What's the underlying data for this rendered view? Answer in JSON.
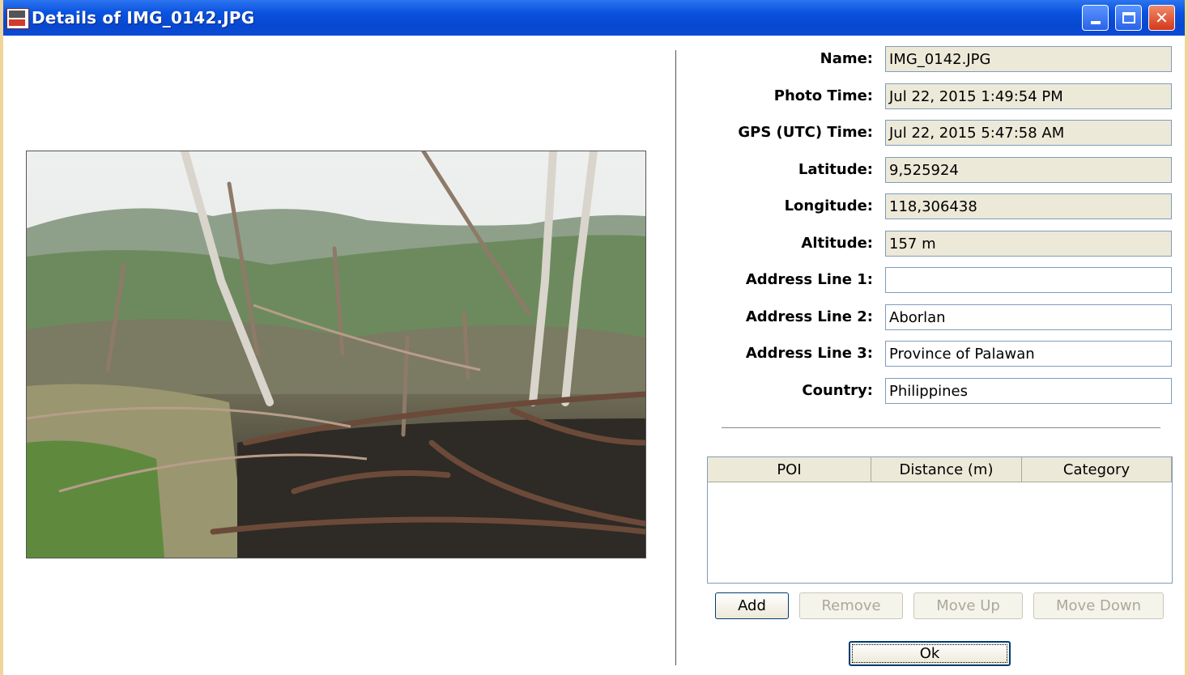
{
  "window": {
    "title": "Details of IMG_0142.JPG",
    "icon": "gps-photo-app-icon"
  },
  "photo": {
    "description_icon": "photo-preview"
  },
  "fields": [
    {
      "label": "Name:",
      "value": "IMG_0142.JPG",
      "editable": false
    },
    {
      "label": "Photo Time:",
      "value": "Jul 22, 2015 1:49:54 PM",
      "editable": false
    },
    {
      "label": "GPS (UTC) Time:",
      "value": "Jul 22, 2015 5:47:58 AM",
      "editable": false
    },
    {
      "label": "Latitude:",
      "value": "9,525924",
      "editable": false
    },
    {
      "label": "Longitude:",
      "value": "118,306438",
      "editable": false
    },
    {
      "label": "Altitude:",
      "value": "157 m",
      "editable": false
    },
    {
      "label": "Address Line 1:",
      "value": "",
      "editable": true
    },
    {
      "label": "Address Line 2:",
      "value": "Aborlan",
      "editable": true
    },
    {
      "label": "Address Line 3:",
      "value": "Province of Palawan",
      "editable": true
    },
    {
      "label": "Country:",
      "value": "Philippines",
      "editable": true
    }
  ],
  "poi_table": {
    "columns": [
      "POI",
      "Distance (m)",
      "Category"
    ],
    "rows": []
  },
  "buttons": {
    "add": "Add",
    "remove": "Remove",
    "move_up": "Move Up",
    "move_down": "Move Down",
    "ok": "Ok"
  },
  "colors": {
    "titlebar": "#0a53e0",
    "readonly_field": "#ece9d8",
    "field_border": "#7f9db9"
  }
}
